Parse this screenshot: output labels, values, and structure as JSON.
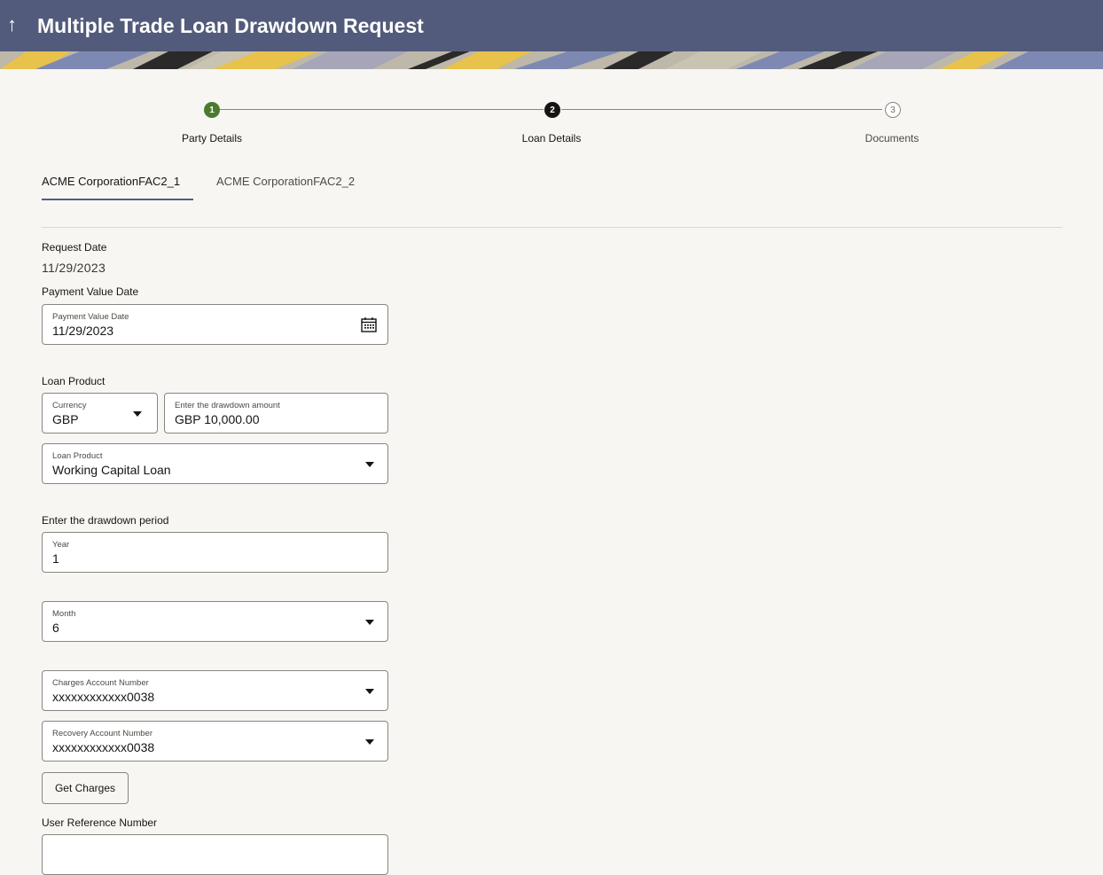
{
  "header": {
    "back_icon": "↑",
    "title": "Multiple Trade Loan Drawdown Request",
    "color": "#535b7c"
  },
  "stepper": {
    "steps": [
      {
        "num": "1",
        "label": "Party Details",
        "state": "completed",
        "color": "#4b7a2e"
      },
      {
        "num": "2",
        "label": "Loan Details",
        "state": "current",
        "color": "#161513"
      },
      {
        "num": "3",
        "label": "Documents",
        "state": "pending",
        "color": "#8a8580"
      }
    ]
  },
  "tabs": [
    {
      "label": "ACME CorporationFAC2_1",
      "active": true
    },
    {
      "label": "ACME CorporationFAC2_2",
      "active": false
    }
  ],
  "form": {
    "request_date": {
      "label": "Request Date",
      "value": "11/29/2023"
    },
    "payment_value_date": {
      "section_label": "Payment Value Date",
      "field_label": "Payment Value Date",
      "value": "11/29/2023",
      "icon": "calendar-icon"
    },
    "loan_product_section": "Loan Product",
    "currency": {
      "label": "Currency",
      "value": "GBP"
    },
    "drawdown_amount": {
      "label": "Enter the drawdown amount",
      "value": "GBP 10,000.00"
    },
    "loan_product": {
      "label": "Loan Product",
      "value": "Working Capital Loan"
    },
    "drawdown_period_section": "Enter the drawdown period",
    "year": {
      "label": "Year",
      "value": "1"
    },
    "month": {
      "label": "Month",
      "value": "6"
    },
    "charges_account": {
      "label": "Charges Account Number",
      "value": "xxxxxxxxxxxx0038"
    },
    "recovery_account": {
      "label": "Recovery Account Number",
      "value": "xxxxxxxxxxxx0038"
    },
    "get_charges_button": "Get Charges",
    "user_reference_label": "User Reference Number"
  }
}
